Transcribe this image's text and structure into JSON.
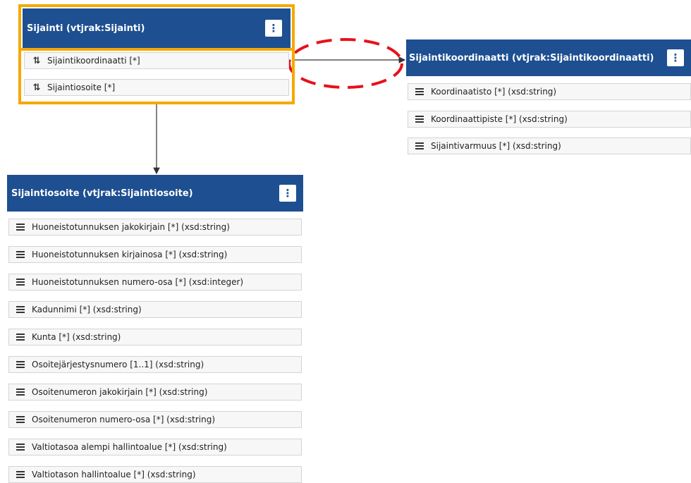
{
  "colors": {
    "header": "#1d4f91",
    "selection": "#f5a800",
    "highlight": "#e8101c",
    "edge": "#333333"
  },
  "menu_glyph": "⋮",
  "icons": {
    "association": "up-down-arrows-icon",
    "attribute": "stacked-lines-icon",
    "menu": "vertical-dots-icon"
  },
  "sijainti": {
    "title": "Sijainti (vtjrak:Sijainti)",
    "rows": [
      "Sijaintikoordinaatti [*]",
      "Sijaintiosoite [*]"
    ]
  },
  "sijaintikoordinaatti": {
    "title": "Sijaintikoordinaatti (vtjrak:Sijaintikoordinaatti)",
    "rows": [
      "Koordinaatisto [*] (xsd:string)",
      "Koordinaattipiste [*] (xsd:string)",
      "Sijaintivarmuus [*] (xsd:string)"
    ]
  },
  "sijaintiosoite": {
    "title": "Sijaintiosoite (vtjrak:Sijaintiosoite)",
    "rows": [
      "Huoneistotunnuksen jakokirjain [*] (xsd:string)",
      "Huoneistotunnuksen kirjainosa [*] (xsd:string)",
      "Huoneistotunnuksen numero-osa [*] (xsd:integer)",
      "Kadunnimi [*] (xsd:string)",
      "Kunta [*] (xsd:string)",
      "Osoitejärjestysnumero [1..1] (xsd:string)",
      "Osoitenumeron jakokirjain [*] (xsd:string)",
      "Osoitenumeron numero-osa [*] (xsd:string)",
      "Valtiotasoa alempi hallintoalue [*] (xsd:string)",
      "Valtiotason hallintoalue [*] (xsd:string)"
    ]
  }
}
